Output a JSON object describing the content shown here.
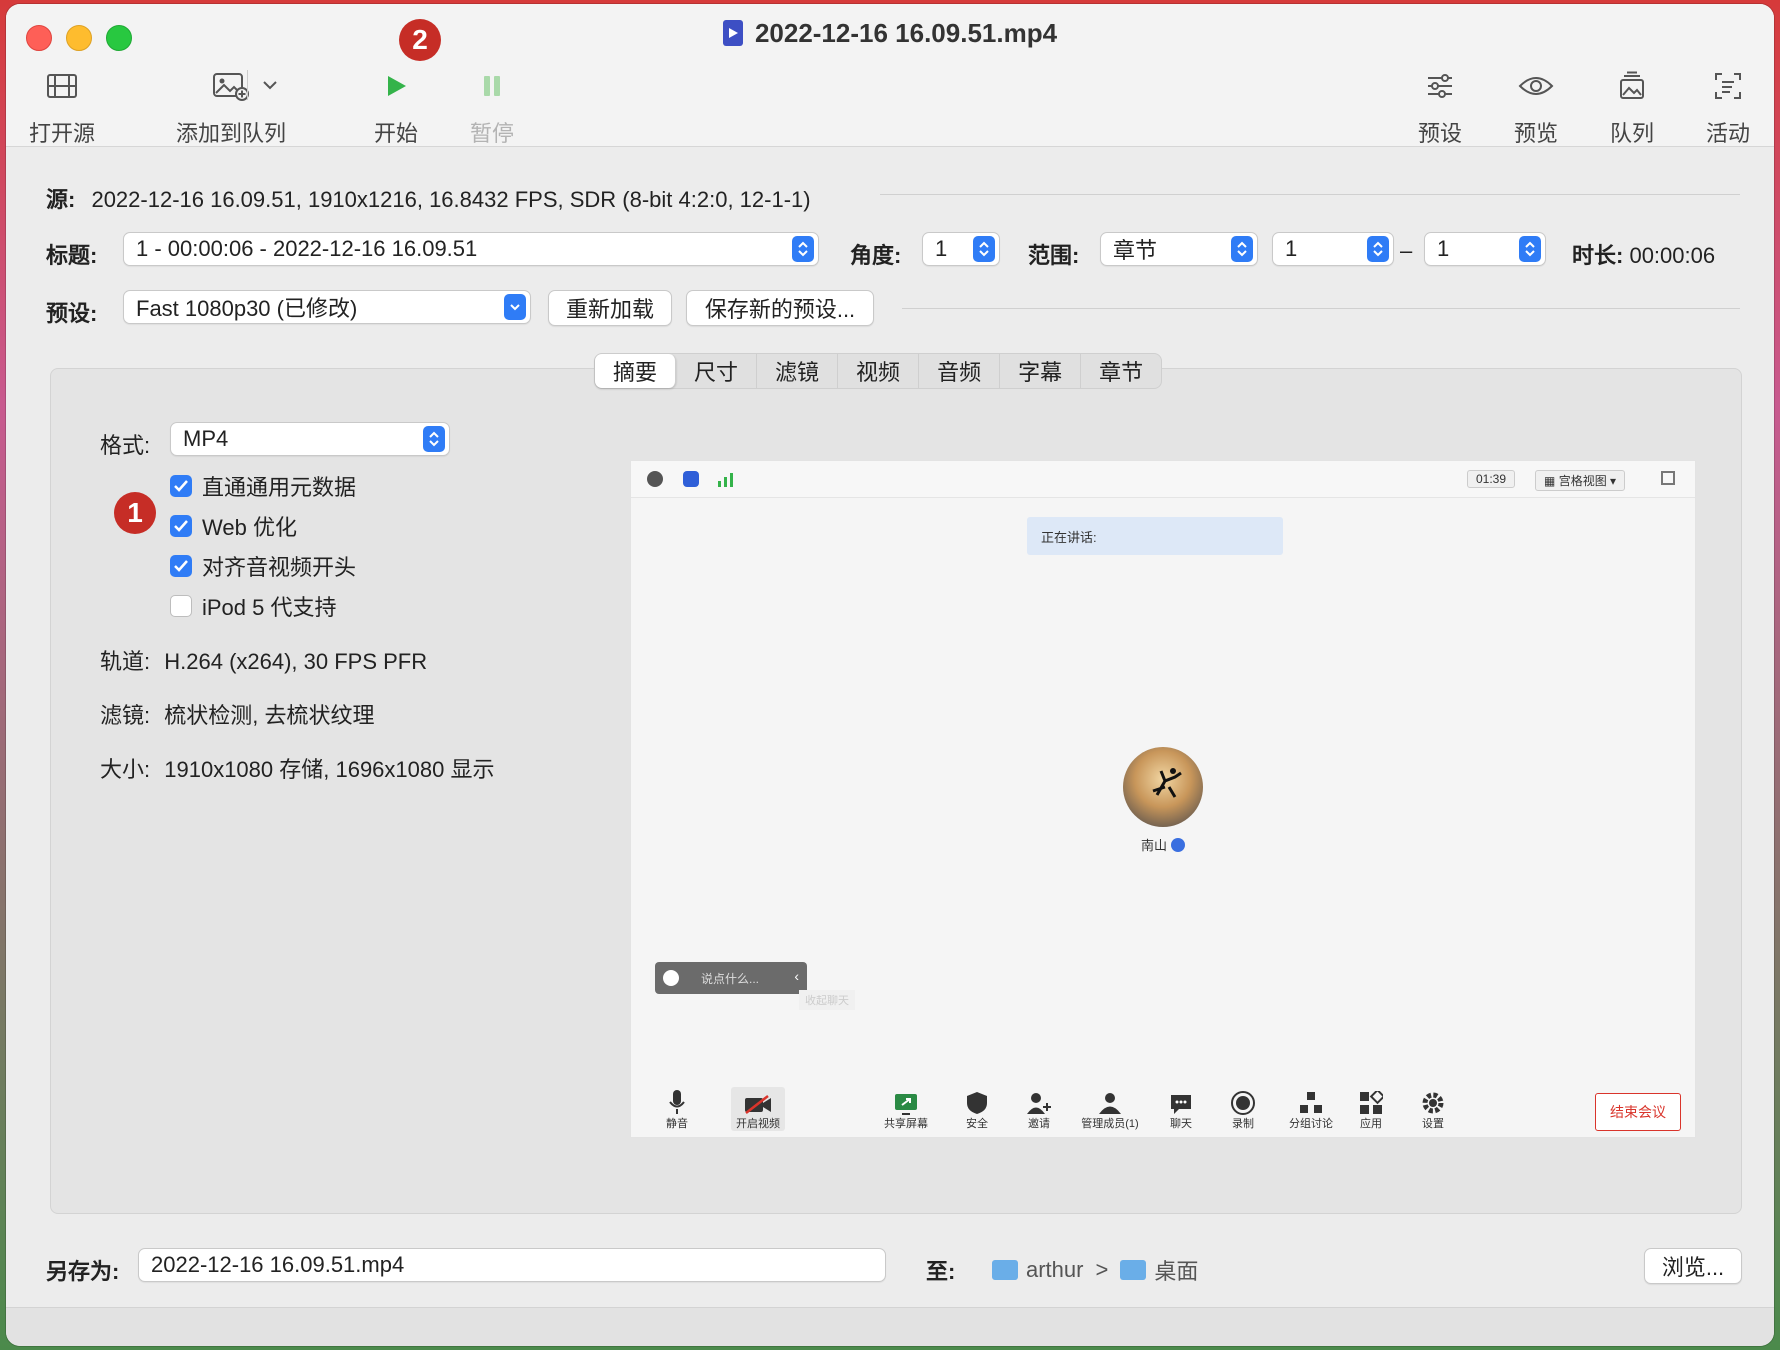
{
  "window": {
    "title": "2022-12-16 16.09.51.mp4"
  },
  "toolbar": {
    "open_source": "打开源",
    "add_to_queue": "添加到队列",
    "start": "开始",
    "pause": "暂停",
    "presets": "预设",
    "preview": "预览",
    "queue": "队列",
    "activity": "活动"
  },
  "badges": {
    "one": "1",
    "two": "2"
  },
  "source": {
    "label": "源:",
    "value": "2022-12-16 16.09.51, 1910x1216, 16.8432 FPS, SDR (8-bit 4:2:0, 12-1-1)"
  },
  "title_row": {
    "label": "标题:",
    "value": "1 - 00:00:06 - 2022-12-16 16.09.51",
    "angle_label": "角度:",
    "angle_value": "1",
    "range_label": "范围:",
    "range_type": "章节",
    "range_start": "1",
    "range_dash": "–",
    "range_end": "1",
    "duration_label": "时长:",
    "duration_value": "00:00:06"
  },
  "preset_row": {
    "label": "预设:",
    "value": "Fast 1080p30 (已修改)",
    "reload": "重新加载",
    "save_new": "保存新的预设..."
  },
  "tabs": [
    "摘要",
    "尺寸",
    "滤镜",
    "视频",
    "音频",
    "字幕",
    "章节"
  ],
  "summary": {
    "format_label": "格式:",
    "format_value": "MP4",
    "checkboxes": [
      {
        "label": "直通通用元数据",
        "checked": true
      },
      {
        "label": "Web 优化",
        "checked": true
      },
      {
        "label": "对齐音视频开头",
        "checked": true
      },
      {
        "label": "iPod 5 代支持",
        "checked": false
      }
    ],
    "tracks_label": "轨道:",
    "tracks_value": "H.264 (x264), 30 FPS PFR",
    "filters_label": "滤镜:",
    "filters_value": "梳状检测, 去梳状纹理",
    "size_label": "大小:",
    "size_value": "1910x1080 存储, 1696x1080 显示"
  },
  "preview_frame": {
    "timer": "01:39",
    "view_mode": "宫格视图",
    "speaking": "正在讲话:",
    "participant": "南山",
    "chat_placeholder": "说点什么...",
    "collapse_chat": "收起聊天",
    "bar": [
      "静音",
      "开启视频",
      "共享屏幕",
      "安全",
      "邀请",
      "管理成员(1)",
      "聊天",
      "录制",
      "分组讨论",
      "应用",
      "设置"
    ],
    "end_meeting": "结束会议"
  },
  "save": {
    "label": "另存为:",
    "filename": "2022-12-16 16.09.51.mp4",
    "to_label": "至:",
    "path_user": "arthur",
    "path_sep": ">",
    "path_folder": "桌面",
    "browse": "浏览..."
  },
  "colors": {
    "accent": "#2f7cf6",
    "badge": "#c62d26",
    "end_meeting": "#d9342b"
  }
}
